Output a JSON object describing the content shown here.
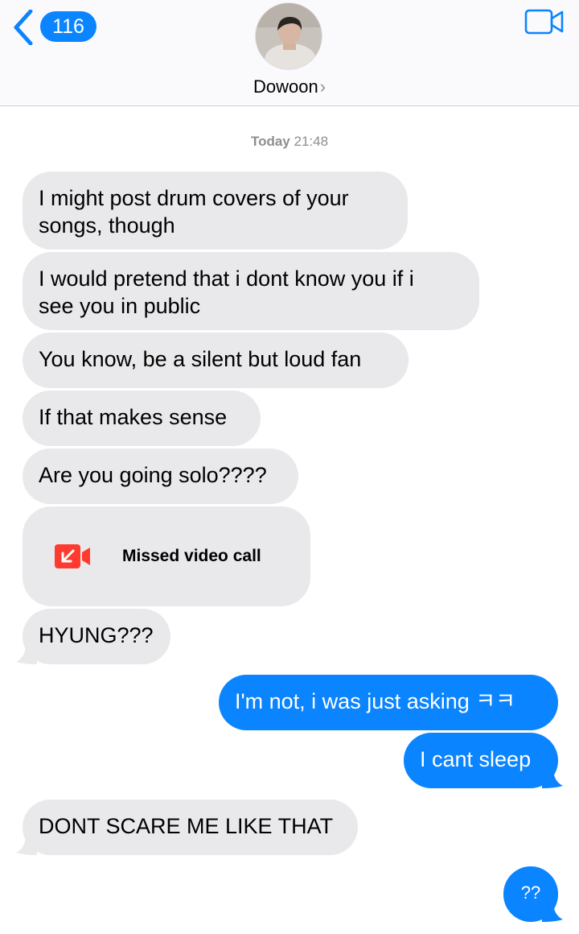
{
  "header": {
    "back_count": "116",
    "contact_name": "Dowoon",
    "contact_chevron": "›",
    "icons": {
      "back": "chevron-left-icon",
      "video": "video-camera-icon"
    },
    "accent_color": "#0b84ff"
  },
  "conversation": {
    "timestamp_day": "Today",
    "timestamp_time": "21:48",
    "messages": [
      {
        "direction": "received",
        "line1": "I might post drum covers of your",
        "line2": "songs, though"
      },
      {
        "direction": "received",
        "line1": "I would pretend that i dont know you if i",
        "line2": "see you in public"
      },
      {
        "direction": "received",
        "text": "You know, be a silent but loud fan"
      },
      {
        "direction": "received",
        "text": "If that makes sense"
      },
      {
        "direction": "received",
        "text": "Are you going solo????"
      },
      {
        "direction": "received",
        "type": "missed-call",
        "text": "Missed video call",
        "icon": "missed-video-call-icon",
        "icon_color": "#ff3b30"
      },
      {
        "direction": "received",
        "text": "HYUNG???"
      },
      {
        "direction": "sent",
        "text": "I'm not, i was just asking ㅋㅋ"
      },
      {
        "direction": "sent",
        "text": "I cant sleep"
      },
      {
        "direction": "received",
        "text": "DONT SCARE ME LIKE THAT"
      },
      {
        "direction": "sent",
        "text": "??"
      }
    ]
  },
  "colors": {
    "received_bubble": "#e9e9eb",
    "sent_bubble": "#0b84ff",
    "timestamp": "#8e8e93"
  }
}
